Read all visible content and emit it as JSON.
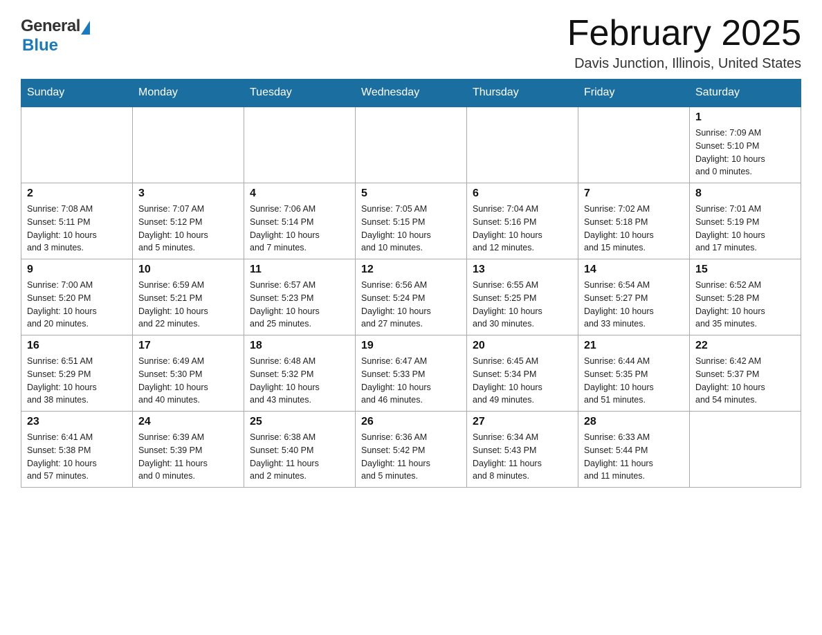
{
  "header": {
    "logo_general": "General",
    "logo_blue": "Blue",
    "month_title": "February 2025",
    "location": "Davis Junction, Illinois, United States"
  },
  "calendar": {
    "weekdays": [
      "Sunday",
      "Monday",
      "Tuesday",
      "Wednesday",
      "Thursday",
      "Friday",
      "Saturday"
    ],
    "weeks": [
      [
        {
          "day": "",
          "info": ""
        },
        {
          "day": "",
          "info": ""
        },
        {
          "day": "",
          "info": ""
        },
        {
          "day": "",
          "info": ""
        },
        {
          "day": "",
          "info": ""
        },
        {
          "day": "",
          "info": ""
        },
        {
          "day": "1",
          "info": "Sunrise: 7:09 AM\nSunset: 5:10 PM\nDaylight: 10 hours\nand 0 minutes."
        }
      ],
      [
        {
          "day": "2",
          "info": "Sunrise: 7:08 AM\nSunset: 5:11 PM\nDaylight: 10 hours\nand 3 minutes."
        },
        {
          "day": "3",
          "info": "Sunrise: 7:07 AM\nSunset: 5:12 PM\nDaylight: 10 hours\nand 5 minutes."
        },
        {
          "day": "4",
          "info": "Sunrise: 7:06 AM\nSunset: 5:14 PM\nDaylight: 10 hours\nand 7 minutes."
        },
        {
          "day": "5",
          "info": "Sunrise: 7:05 AM\nSunset: 5:15 PM\nDaylight: 10 hours\nand 10 minutes."
        },
        {
          "day": "6",
          "info": "Sunrise: 7:04 AM\nSunset: 5:16 PM\nDaylight: 10 hours\nand 12 minutes."
        },
        {
          "day": "7",
          "info": "Sunrise: 7:02 AM\nSunset: 5:18 PM\nDaylight: 10 hours\nand 15 minutes."
        },
        {
          "day": "8",
          "info": "Sunrise: 7:01 AM\nSunset: 5:19 PM\nDaylight: 10 hours\nand 17 minutes."
        }
      ],
      [
        {
          "day": "9",
          "info": "Sunrise: 7:00 AM\nSunset: 5:20 PM\nDaylight: 10 hours\nand 20 minutes."
        },
        {
          "day": "10",
          "info": "Sunrise: 6:59 AM\nSunset: 5:21 PM\nDaylight: 10 hours\nand 22 minutes."
        },
        {
          "day": "11",
          "info": "Sunrise: 6:57 AM\nSunset: 5:23 PM\nDaylight: 10 hours\nand 25 minutes."
        },
        {
          "day": "12",
          "info": "Sunrise: 6:56 AM\nSunset: 5:24 PM\nDaylight: 10 hours\nand 27 minutes."
        },
        {
          "day": "13",
          "info": "Sunrise: 6:55 AM\nSunset: 5:25 PM\nDaylight: 10 hours\nand 30 minutes."
        },
        {
          "day": "14",
          "info": "Sunrise: 6:54 AM\nSunset: 5:27 PM\nDaylight: 10 hours\nand 33 minutes."
        },
        {
          "day": "15",
          "info": "Sunrise: 6:52 AM\nSunset: 5:28 PM\nDaylight: 10 hours\nand 35 minutes."
        }
      ],
      [
        {
          "day": "16",
          "info": "Sunrise: 6:51 AM\nSunset: 5:29 PM\nDaylight: 10 hours\nand 38 minutes."
        },
        {
          "day": "17",
          "info": "Sunrise: 6:49 AM\nSunset: 5:30 PM\nDaylight: 10 hours\nand 40 minutes."
        },
        {
          "day": "18",
          "info": "Sunrise: 6:48 AM\nSunset: 5:32 PM\nDaylight: 10 hours\nand 43 minutes."
        },
        {
          "day": "19",
          "info": "Sunrise: 6:47 AM\nSunset: 5:33 PM\nDaylight: 10 hours\nand 46 minutes."
        },
        {
          "day": "20",
          "info": "Sunrise: 6:45 AM\nSunset: 5:34 PM\nDaylight: 10 hours\nand 49 minutes."
        },
        {
          "day": "21",
          "info": "Sunrise: 6:44 AM\nSunset: 5:35 PM\nDaylight: 10 hours\nand 51 minutes."
        },
        {
          "day": "22",
          "info": "Sunrise: 6:42 AM\nSunset: 5:37 PM\nDaylight: 10 hours\nand 54 minutes."
        }
      ],
      [
        {
          "day": "23",
          "info": "Sunrise: 6:41 AM\nSunset: 5:38 PM\nDaylight: 10 hours\nand 57 minutes."
        },
        {
          "day": "24",
          "info": "Sunrise: 6:39 AM\nSunset: 5:39 PM\nDaylight: 11 hours\nand 0 minutes."
        },
        {
          "day": "25",
          "info": "Sunrise: 6:38 AM\nSunset: 5:40 PM\nDaylight: 11 hours\nand 2 minutes."
        },
        {
          "day": "26",
          "info": "Sunrise: 6:36 AM\nSunset: 5:42 PM\nDaylight: 11 hours\nand 5 minutes."
        },
        {
          "day": "27",
          "info": "Sunrise: 6:34 AM\nSunset: 5:43 PM\nDaylight: 11 hours\nand 8 minutes."
        },
        {
          "day": "28",
          "info": "Sunrise: 6:33 AM\nSunset: 5:44 PM\nDaylight: 11 hours\nand 11 minutes."
        },
        {
          "day": "",
          "info": ""
        }
      ]
    ]
  }
}
